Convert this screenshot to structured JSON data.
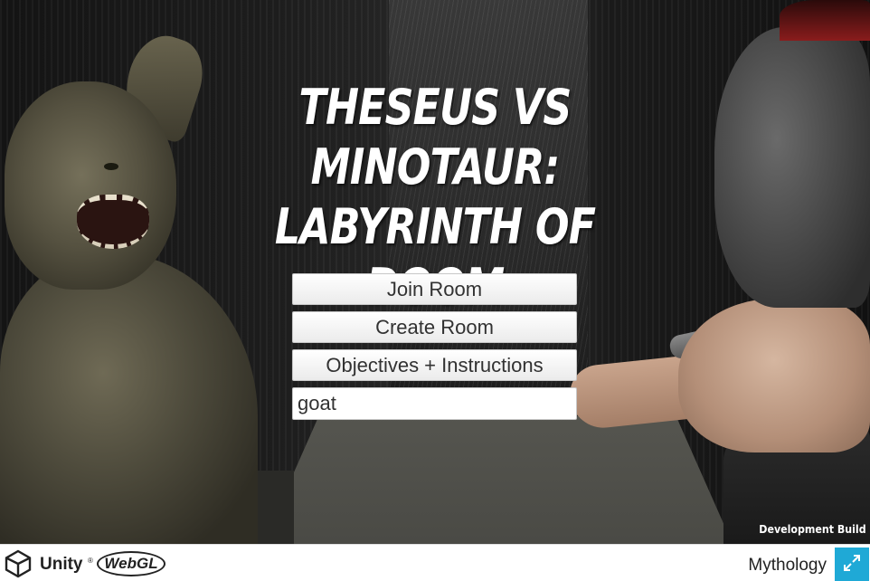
{
  "game": {
    "title_line1": "Theseus vs Minotaur:",
    "title_line2": "Labyrinth of Doom",
    "dev_build_label": "Development Build"
  },
  "menu": {
    "join_room_label": "Join Room",
    "create_room_label": "Create Room",
    "objectives_label": "Objectives + Instructions",
    "name_input_value": "goat"
  },
  "footer": {
    "unity_label": "Unity",
    "unity_tm": "®",
    "webgl_label": "WebGL",
    "project_name": "Mythology",
    "fullscreen_icon": "fullscreen-icon",
    "accent_color": "#1fa9d6"
  }
}
